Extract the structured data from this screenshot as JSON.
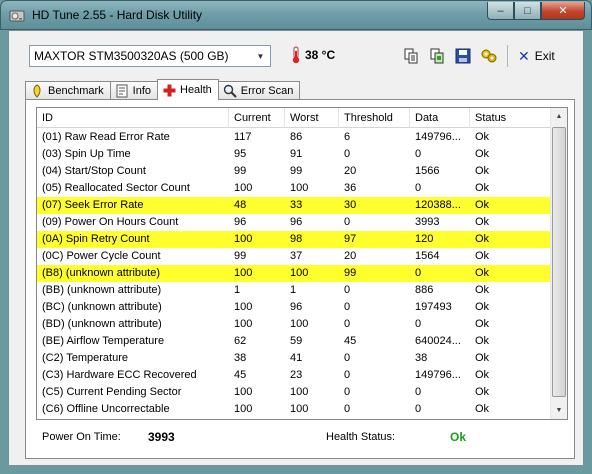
{
  "window": {
    "title": "HD Tune 2.55 - Hard Disk Utility",
    "buttons": {
      "minimize": "–",
      "maximize": "□",
      "close": "✕"
    }
  },
  "toolbar": {
    "drive": "MAXTOR STM3500320AS (500 GB)",
    "temperature": "38 °C",
    "exit_label": "Exit",
    "icons": [
      "copy-text-icon",
      "copy-screenshot-icon",
      "save-icon",
      "options-icon"
    ]
  },
  "tabs": [
    {
      "label": "Benchmark",
      "icon": "benchmark-icon",
      "active": false
    },
    {
      "label": "Info",
      "icon": "info-icon",
      "active": false
    },
    {
      "label": "Health",
      "icon": "health-icon",
      "active": true
    },
    {
      "label": "Error Scan",
      "icon": "error-scan-icon",
      "active": false
    }
  ],
  "health_table": {
    "columns": [
      "ID",
      "Current",
      "Worst",
      "Threshold",
      "Data",
      "Status"
    ],
    "rows": [
      {
        "id": "(01) Raw Read Error Rate",
        "current": "117",
        "worst": "86",
        "threshold": "6",
        "data": "149796...",
        "status": "Ok",
        "highlight": false
      },
      {
        "id": "(03) Spin Up Time",
        "current": "95",
        "worst": "91",
        "threshold": "0",
        "data": "0",
        "status": "Ok",
        "highlight": false
      },
      {
        "id": "(04) Start/Stop Count",
        "current": "99",
        "worst": "99",
        "threshold": "20",
        "data": "1566",
        "status": "Ok",
        "highlight": false
      },
      {
        "id": "(05) Reallocated Sector Count",
        "current": "100",
        "worst": "100",
        "threshold": "36",
        "data": "0",
        "status": "Ok",
        "highlight": false
      },
      {
        "id": "(07) Seek Error Rate",
        "current": "48",
        "worst": "33",
        "threshold": "30",
        "data": "120388...",
        "status": "Ok",
        "highlight": true
      },
      {
        "id": "(09) Power On Hours Count",
        "current": "96",
        "worst": "96",
        "threshold": "0",
        "data": "3993",
        "status": "Ok",
        "highlight": false
      },
      {
        "id": "(0A) Spin Retry Count",
        "current": "100",
        "worst": "98",
        "threshold": "97",
        "data": "120",
        "status": "Ok",
        "highlight": true
      },
      {
        "id": "(0C) Power Cycle Count",
        "current": "99",
        "worst": "37",
        "threshold": "20",
        "data": "1564",
        "status": "Ok",
        "highlight": false
      },
      {
        "id": "(B8) (unknown attribute)",
        "current": "100",
        "worst": "100",
        "threshold": "99",
        "data": "0",
        "status": "Ok",
        "highlight": true
      },
      {
        "id": "(BB) (unknown attribute)",
        "current": "1",
        "worst": "1",
        "threshold": "0",
        "data": "886",
        "status": "Ok",
        "highlight": false
      },
      {
        "id": "(BC) (unknown attribute)",
        "current": "100",
        "worst": "96",
        "threshold": "0",
        "data": "197493",
        "status": "Ok",
        "highlight": false
      },
      {
        "id": "(BD) (unknown attribute)",
        "current": "100",
        "worst": "100",
        "threshold": "0",
        "data": "0",
        "status": "Ok",
        "highlight": false
      },
      {
        "id": "(BE) Airflow Temperature",
        "current": "62",
        "worst": "59",
        "threshold": "45",
        "data": "640024...",
        "status": "Ok",
        "highlight": false
      },
      {
        "id": "(C2) Temperature",
        "current": "38",
        "worst": "41",
        "threshold": "0",
        "data": "38",
        "status": "Ok",
        "highlight": false
      },
      {
        "id": "(C3) Hardware ECC Recovered",
        "current": "45",
        "worst": "23",
        "threshold": "0",
        "data": "149796...",
        "status": "Ok",
        "highlight": false
      },
      {
        "id": "(C5) Current Pending Sector",
        "current": "100",
        "worst": "100",
        "threshold": "0",
        "data": "0",
        "status": "Ok",
        "highlight": false
      },
      {
        "id": "(C6) Offline Uncorrectable",
        "current": "100",
        "worst": "100",
        "threshold": "0",
        "data": "0",
        "status": "Ok",
        "highlight": false
      }
    ]
  },
  "footer": {
    "power_on_label": "Power On Time:",
    "power_on_value": "3993",
    "health_label": "Health Status:",
    "health_value": "Ok"
  },
  "colors": {
    "highlight": "#ffff2e",
    "ok_green": "#1aa01a"
  }
}
